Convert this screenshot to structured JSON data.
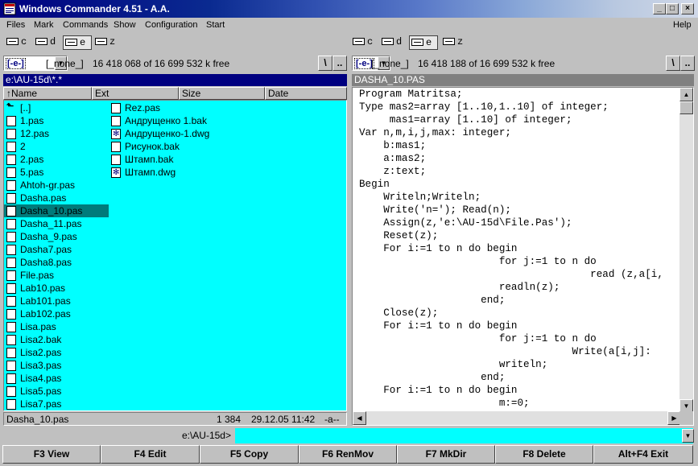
{
  "window": {
    "title": "Windows Commander 4.51 - A.A."
  },
  "menu": [
    "Files",
    "Mark",
    "Commands",
    "Show",
    "Configuration",
    "Start",
    "Help"
  ],
  "drives": [
    "c",
    "d",
    "e",
    "z"
  ],
  "active_drive": "e",
  "left": {
    "drive_combo": "[-e-]",
    "volume": "[_none_]",
    "free": "16 418 068 of 16 699 532 k free",
    "path": "e:\\AU-15d\\*.*",
    "columns": [
      "↑Name",
      "Ext",
      "Size",
      "Date"
    ],
    "files_col1": [
      "[..]",
      "1.pas",
      "12.pas",
      "2",
      "2.pas",
      "5.pas",
      "Ahtoh-gr.pas",
      "Dasha.pas",
      "Dasha_10.pas",
      "Dasha_11.pas",
      "Dasha_9.pas",
      "Dasha7.pas",
      "Dasha8.pas",
      "File.pas",
      "Lab10.pas",
      "Lab101.pas",
      "Lab102.pas",
      "Lisa.pas",
      "Lisa2.bak",
      "Lisa2.pas",
      "Lisa3.pas",
      "Lisa4.pas",
      "Lisa5.pas",
      "Lisa7.pas"
    ],
    "files_col2": [
      "Rez.pas",
      "Андрущенко 1.bak",
      "Андрущенко-1.dwg",
      "Рисунок.bak",
      "Штамп.bak",
      "Штамп.dwg"
    ],
    "selected": "Dasha_10.pas",
    "status": {
      "name": "Dasha_10.pas",
      "size": "1 384",
      "date": "29.12.05 11:42",
      "attr": "-a--"
    }
  },
  "right": {
    "drive_combo": "[-e-]",
    "volume": "[_none_]",
    "free": "16 418 188 of 16 699 532 k free",
    "title": "DASHA_10.PAS",
    "code": [
      "Program Matritsa;",
      "Type mas2=array [1..10,1..10] of integer;",
      "     mas1=array [1..10] of integer;",
      "Var n,m,i,j,max: integer;",
      "    b:mas1;",
      "    a:mas2;",
      "    z:text;",
      "Begin",
      "    Writeln;Writeln;",
      "    Write('n='); Read(n);",
      "    Assign(z,'e:\\AU-15d\\File.Pas');",
      "    Reset(z);",
      "    For i:=1 to n do begin",
      "                       for j:=1 to n do",
      "                                      read (z,a[i,",
      "                       readln(z);",
      "                    end;",
      "    Close(z);",
      "    For i:=1 to n do begin",
      "                       for j:=1 to n do",
      "                                   Write(a[i,j]:",
      "                       writeln;",
      "                    end;",
      "    For i:=1 to n do begin",
      "                       m:=0;"
    ]
  },
  "cmdline": {
    "path": "e:\\AU-15d>",
    "value": ""
  },
  "fkeys": [
    "F3 View",
    "F4 Edit",
    "F5 Copy",
    "F6 RenMov",
    "F7 MkDir",
    "F8 Delete",
    "Alt+F4 Exit"
  ]
}
